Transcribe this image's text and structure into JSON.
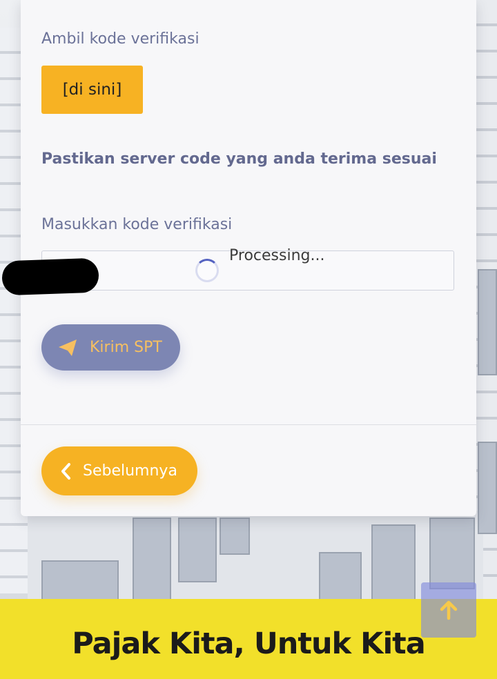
{
  "verification": {
    "get_code_label": "Ambil kode verifikasi",
    "get_code_button": "[di sini]",
    "notice": "Pastikan server code yang anda terima sesuai",
    "enter_code_label": "Masukkan kode verifikasi",
    "code_value": "",
    "processing_text": "Processing..."
  },
  "actions": {
    "send_label": "Kirim SPT",
    "send_icon": "paper-plane-icon",
    "prev_label": "Sebelumnya",
    "prev_icon": "chevron-left-icon"
  },
  "footer": {
    "tagline": "Pajak Kita, Untuk Kita"
  },
  "scroll_top_icon": "arrow-up-icon",
  "colors": {
    "accent_yellow": "#f7b223",
    "send_button": "#7d86b3",
    "footer_bg": "#f2e02a",
    "label_text": "#6b7298"
  }
}
